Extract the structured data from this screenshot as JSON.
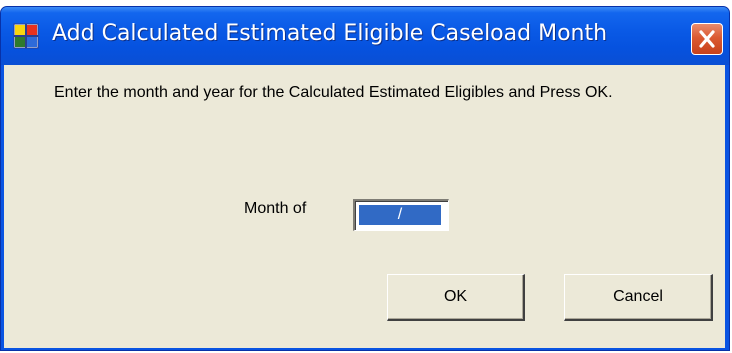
{
  "window": {
    "title": "Add Calculated Estimated Eligible Caseload Month",
    "app_icon": "windows-form-icon",
    "close_icon": "close-icon"
  },
  "dialog": {
    "prompt": "Enter the month and year for the Calculated Estimated Eligibles and Press OK.",
    "month_label": "Month of",
    "month_value": "  /",
    "ok_label": "OK",
    "cancel_label": "Cancel"
  },
  "colors": {
    "titlebar": "#0a54e2",
    "client": "#ece9d8",
    "close": "#db5a32",
    "selection": "#316ac5"
  }
}
